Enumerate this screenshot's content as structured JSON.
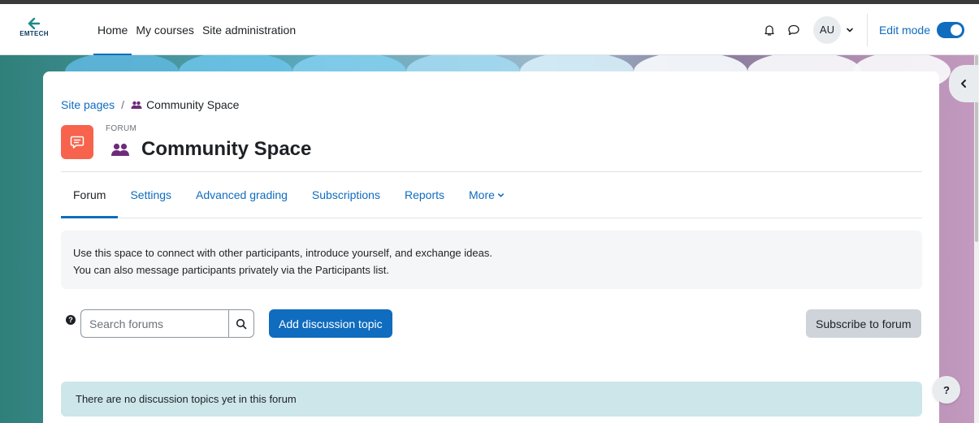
{
  "brand": {
    "name": "EMTECH"
  },
  "nav": {
    "links": [
      {
        "label": "Home",
        "active": true
      },
      {
        "label": "My courses",
        "active": false
      },
      {
        "label": "Site administration",
        "active": false
      }
    ],
    "user_initials": "AU",
    "edit_mode_label": "Edit mode",
    "edit_mode_on": true
  },
  "breadcrumb": {
    "root": "Site pages",
    "separator": "/",
    "current": "Community Space"
  },
  "activity": {
    "type_label": "FORUM",
    "title": "Community Space",
    "icon_color": "#f7634d"
  },
  "tabs": [
    {
      "label": "Forum",
      "active": true
    },
    {
      "label": "Settings",
      "active": false
    },
    {
      "label": "Advanced grading",
      "active": false
    },
    {
      "label": "Subscriptions",
      "active": false
    },
    {
      "label": "Reports",
      "active": false
    },
    {
      "label": "More",
      "active": false
    }
  ],
  "intro": {
    "line1": "Use this space to connect with other participants, introduce yourself, and exchange ideas.",
    "line2": "You can also message participants privately via the Participants list."
  },
  "search": {
    "placeholder": "Search forums"
  },
  "actions": {
    "add_topic": "Add discussion topic",
    "subscribe": "Subscribe to forum"
  },
  "notice": {
    "no_topics": "There are no discussion topics yet in this forum"
  },
  "help": {
    "symbol": "?"
  },
  "colors": {
    "primary": "#0f6cbf",
    "forum_icon": "#f7634d",
    "notice_bg": "#cde6ea"
  },
  "icons": [
    "bell-icon",
    "chat-icon",
    "chevron-down-icon",
    "group-icon",
    "forum-icon",
    "search-icon",
    "question-icon",
    "chevron-left-icon"
  ]
}
